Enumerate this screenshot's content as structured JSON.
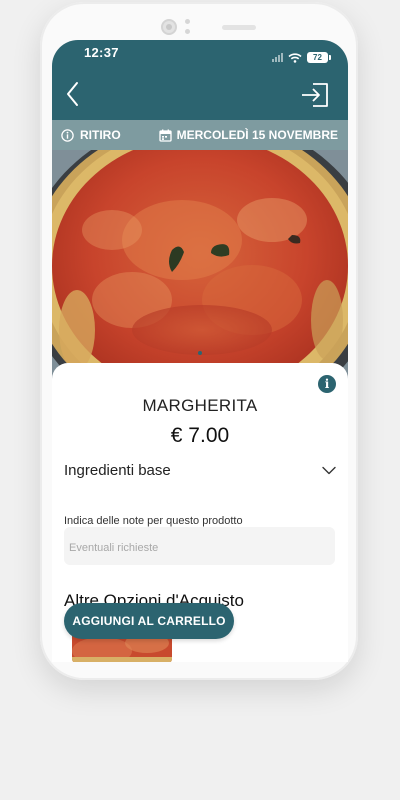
{
  "status": {
    "time": "12:37",
    "battery": "72"
  },
  "header": {
    "back_icon": "chevron-left-icon",
    "login_icon": "login-icon"
  },
  "infobar": {
    "mode": "RITIRO",
    "date": "MERCOLEDÌ 15 NOVEMBRE"
  },
  "product": {
    "name": "MARGHERITA",
    "price": "€ 7.00",
    "ingredients_label": "Ingredienti base",
    "notes_label": "Indica delle note per questo prodotto",
    "notes_placeholder": "Eventuali richieste",
    "notes_value": ""
  },
  "other_options": {
    "title": "Altre Opzioni d'Acquisto"
  },
  "actions": {
    "add_to_cart": "AGGIUNGI AL CARRELLO"
  },
  "colors": {
    "primary": "#2c6470",
    "infobar": "#7e9ba0"
  }
}
